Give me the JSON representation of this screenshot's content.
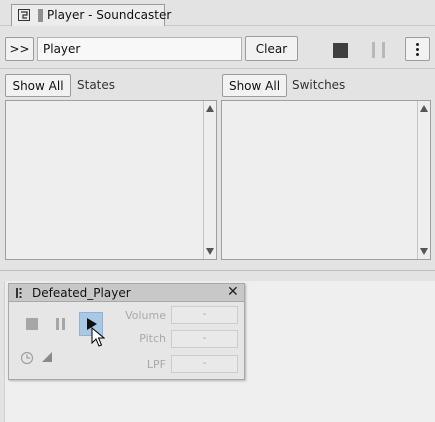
{
  "tab": {
    "title": "Player - Soundcaster"
  },
  "toolbar": {
    "expand_label": ">>",
    "search_value": "Player",
    "clear_label": "Clear"
  },
  "states": {
    "show_all_label": "Show All",
    "title": "States"
  },
  "switches": {
    "show_all_label": "Show All",
    "title": "Switches"
  },
  "player_panel": {
    "title": "Defeated_Player",
    "params": [
      {
        "label": "Volume",
        "value": "-"
      },
      {
        "label": "Pitch",
        "value": "-"
      },
      {
        "label": "LPF",
        "value": "-"
      }
    ]
  },
  "colors": {
    "play_highlight": "#a9c8e4",
    "stop_dark": "#3f3f3f",
    "disabled": "#a6a6a6"
  }
}
